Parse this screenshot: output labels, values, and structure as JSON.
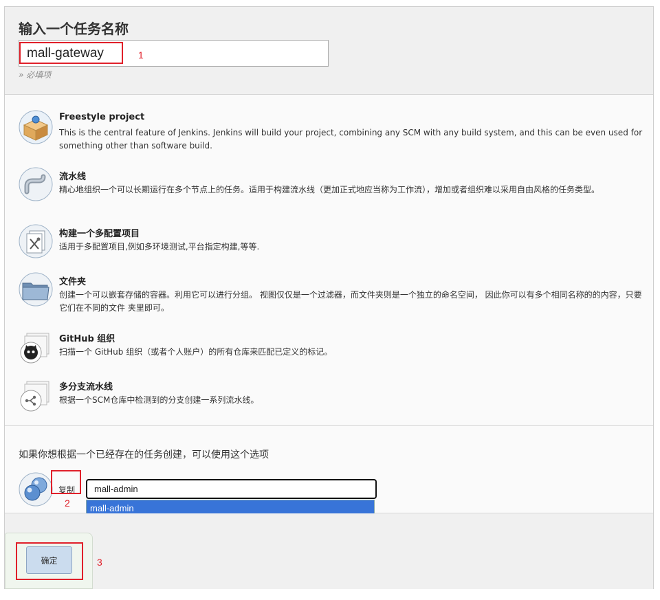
{
  "header": {
    "title": "输入一个任务名称",
    "name_value": "mall-gateway",
    "required_note": "» 必填项"
  },
  "types": [
    {
      "name": "Freestyle project",
      "desc": "This is the central feature of Jenkins. Jenkins will build your project, combining any SCM with any build system, and this can be even used for something other than software build.",
      "icon": "package-box-icon"
    },
    {
      "name": "流水线",
      "desc": "精心地组织一个可以长期运行在多个节点上的任务。适用于构建流水线（更加正式地应当称为工作流），增加或者组织难以采用自由风格的任务类型。",
      "icon": "pipe-icon"
    },
    {
      "name": "构建一个多配置项目",
      "desc": "适用于多配置项目,例如多环境测试,平台指定构建,等等.",
      "icon": "multi-config-icon"
    },
    {
      "name": "文件夹",
      "desc": "创建一个可以嵌套存储的容器。利用它可以进行分组。 视图仅仅是一个过滤器，而文件夹则是一个独立的命名空间， 因此你可以有多个相同名称的的内容，只要它们在不同的文件 夹里即可。",
      "icon": "folder-icon"
    },
    {
      "name": "GitHub 组织",
      "desc": "扫描一个 GitHub 组织（或者个人账户）的所有仓库来匹配已定义的标记。",
      "icon": "github-org-icon"
    },
    {
      "name": "多分支流水线",
      "desc": "根据一个SCM仓库中检测到的分支创建一系列流水线。",
      "icon": "branch-pipeline-icon"
    }
  ],
  "copy": {
    "title": "如果你想根据一个已经存在的任务创建，可以使用这个选项",
    "label": "复制",
    "value": "mall-admin",
    "suggestion": "mall-admin"
  },
  "ok_label": "确定",
  "annotations": [
    "1",
    "2",
    "3"
  ],
  "colors": {
    "annotation": "#e0202a",
    "autocomplete_highlight": "#3874d8",
    "ok_button": "#cbdcee"
  }
}
